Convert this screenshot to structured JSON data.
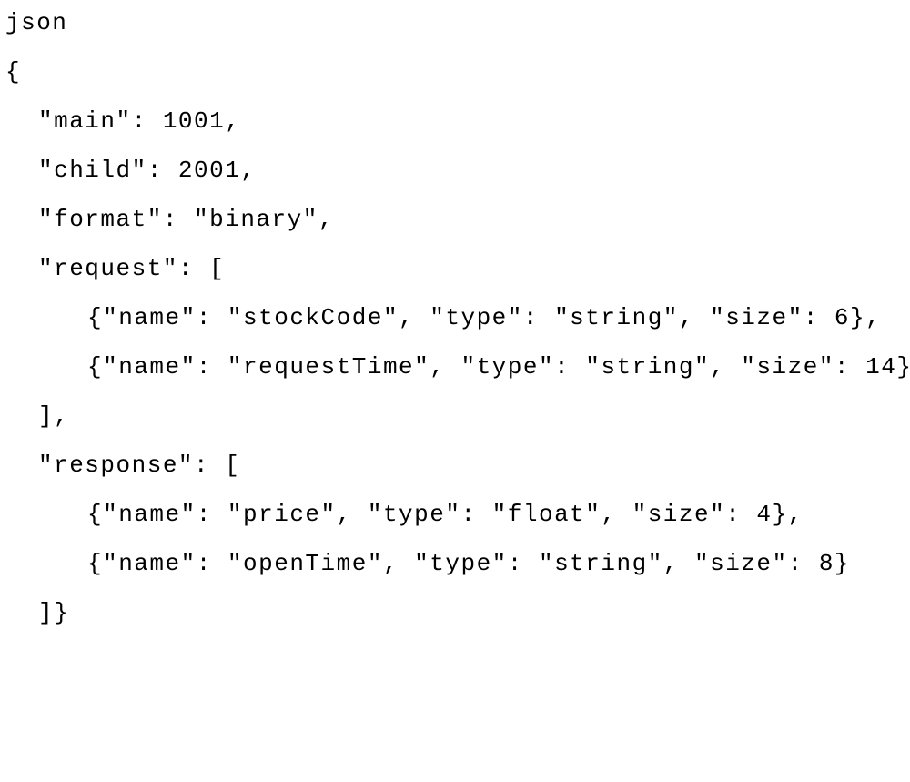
{
  "code": {
    "line1": "json",
    "line2": "{",
    "line3": "\"main\": 1001,",
    "line4": "\"child\": 2001,",
    "line5": "\"format\": \"binary\",",
    "line6": "\"request\": [",
    "line7": "{\"name\": \"stockCode\", \"type\": \"string\", \"size\": 6},",
    "line8": "{\"name\": \"requestTime\", \"type\": \"string\", \"size\": 14}",
    "line9": "],",
    "line10": "\"response\": [",
    "line11": "{\"name\": \"price\", \"type\": \"float\", \"size\": 4},",
    "line12": "{\"name\": \"openTime\", \"type\": \"string\", \"size\": 8}",
    "line13": "]}"
  }
}
